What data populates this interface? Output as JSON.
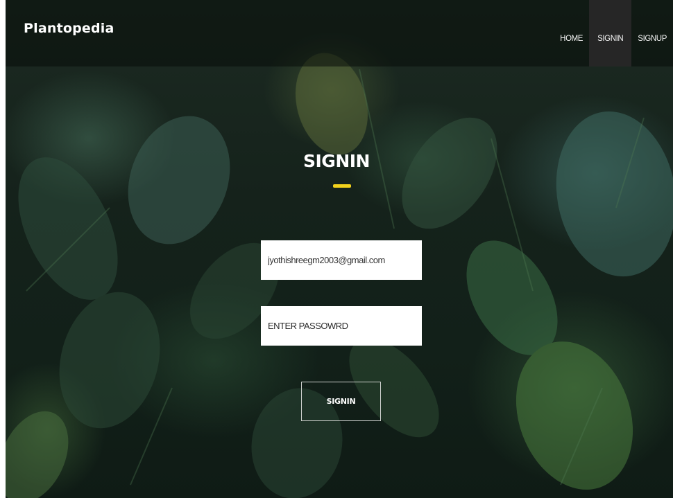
{
  "brand": "Plantopedia",
  "nav": {
    "home": "HOME",
    "signin": "SIGNIN",
    "signup": "SIGNUP"
  },
  "form": {
    "title": "SIGNIN",
    "email_value": "jyothishreegm2003@gmail.com",
    "password_placeholder": "ENTER PASSOWRD",
    "submit_label": "SIGNIN"
  },
  "colors": {
    "accent": "#f2d21c",
    "navbar_active": "#262626",
    "background": "#15221b"
  }
}
